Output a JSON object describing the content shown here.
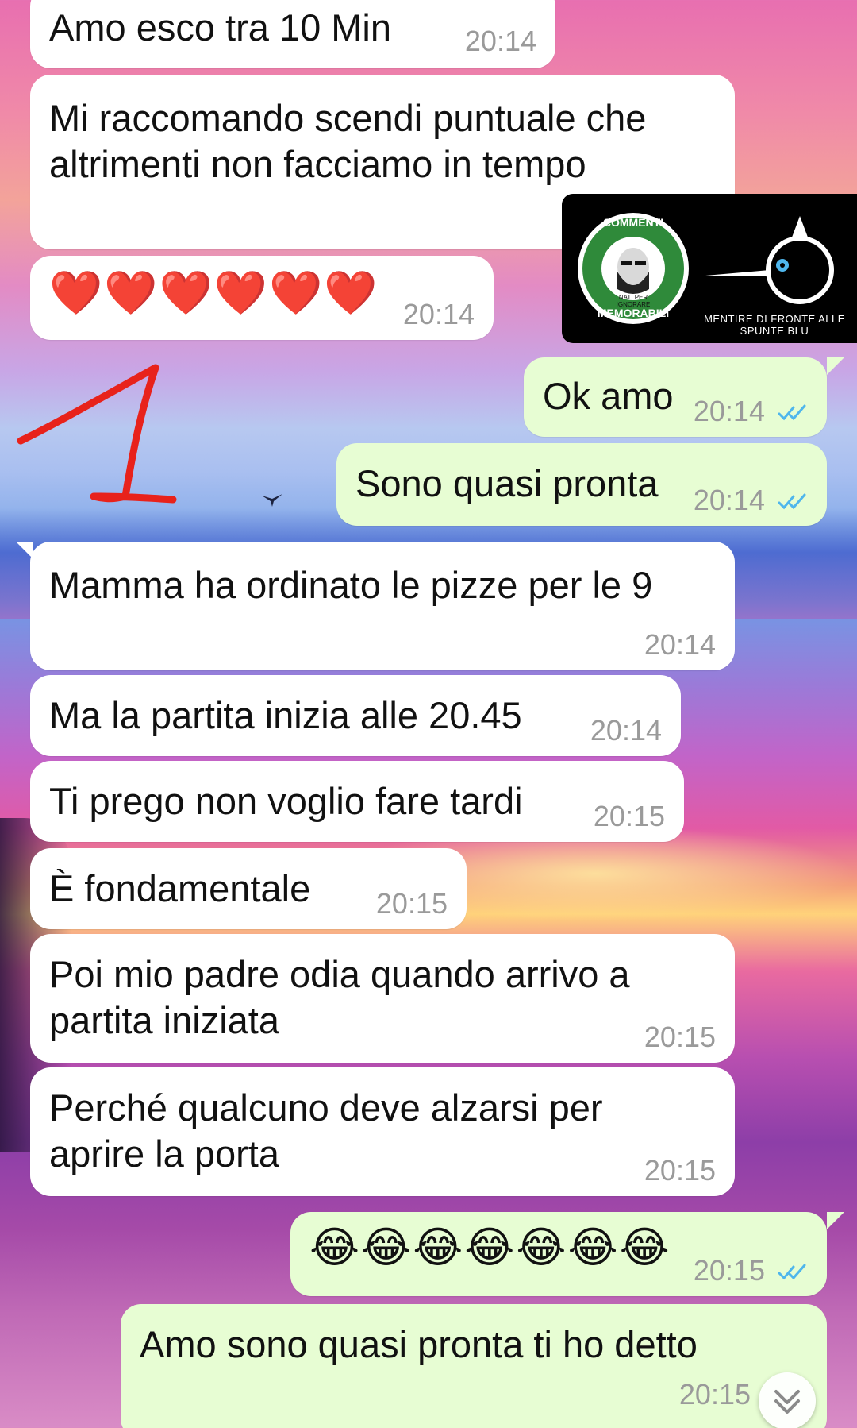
{
  "chat": {
    "messages": [
      {
        "dir": "in",
        "text": "Amo esco tra 10 Min",
        "time": "20:14"
      },
      {
        "dir": "in",
        "text_lines": [
          "Mi raccomando scendi puntuale che",
          "altrimenti non facciamo in tempo"
        ]
      },
      {
        "dir": "in",
        "text": "❤️❤️❤️❤️❤️❤️",
        "time": "20:14"
      },
      {
        "dir": "out",
        "text": "Ok amo",
        "time": "20:14",
        "status": "read"
      },
      {
        "dir": "out",
        "text": "Sono quasi pronta",
        "time": "20:14",
        "status": "read"
      },
      {
        "dir": "in",
        "text": "Mamma ha ordinato le pizze per le 9",
        "time": "20:14"
      },
      {
        "dir": "in",
        "text": "Ma la partita inizia alle 20.45",
        "time": "20:14"
      },
      {
        "dir": "in",
        "text": "Ti prego non voglio fare tardi",
        "time": "20:15"
      },
      {
        "dir": "in",
        "text": "È fondamentale",
        "time": "20:15"
      },
      {
        "dir": "in",
        "text_lines": [
          "Poi mio padre odia quando arrivo a",
          "partita iniziata"
        ],
        "time": "20:15"
      },
      {
        "dir": "in",
        "text_lines": [
          "Perché qualcuno deve alzarsi per",
          "aprire la porta"
        ],
        "time": "20:15"
      },
      {
        "dir": "out",
        "text": "😂😂😂😂😂😂😂",
        "time": "20:15",
        "status": "read"
      },
      {
        "dir": "out",
        "text": "Amo sono quasi pronta ti ho detto",
        "time": "20:15"
      }
    ]
  },
  "watermark": {
    "badge_top": "COMMENTI",
    "badge_bottom": "MEMORABILI",
    "badge_small": "NATI PER IGNORARE",
    "caption": "MENTIRE DI FRONTE ALLE SPUNTE BLU"
  },
  "annotation": {
    "mark": "1",
    "color": "#e8221b"
  },
  "colors": {
    "incoming_bubble": "#ffffff",
    "outgoing_bubble": "#e7fdd3",
    "read_ticks": "#4fb6ec",
    "timestamp": "#9a9a9a",
    "badge_green": "#2f8a3a"
  },
  "icons": {
    "read_status": "double-check-icon",
    "scroll_down": "chevron-double-down-icon"
  }
}
